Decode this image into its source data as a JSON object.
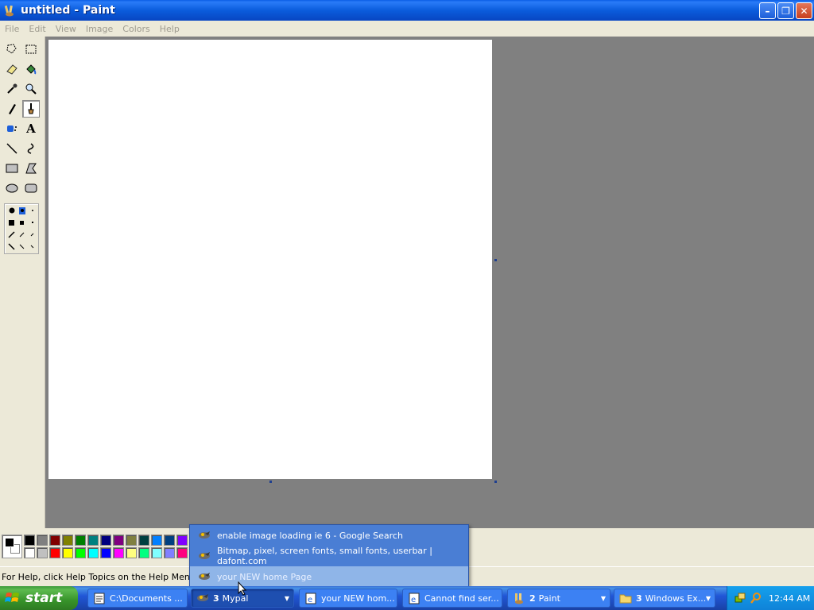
{
  "window": {
    "title": "untitled - Paint",
    "buttons": {
      "minimize": "–",
      "restore": "❐",
      "close": "✕"
    }
  },
  "menu": [
    "File",
    "Edit",
    "View",
    "Image",
    "Colors",
    "Help"
  ],
  "tools": [
    "free-form-select",
    "select",
    "eraser",
    "fill-with-color",
    "pick-color",
    "magnifier",
    "pencil",
    "brush",
    "airbrush",
    "text",
    "line",
    "curve",
    "rectangle",
    "polygon",
    "ellipse",
    "rounded-rectangle"
  ],
  "text_tool_label": "A",
  "palette": {
    "top": [
      "#000000",
      "#808080",
      "#800000",
      "#808000",
      "#008000",
      "#008080",
      "#000080",
      "#800080",
      "#808040",
      "#004040",
      "#0080ff",
      "#004080",
      "#8000ff"
    ],
    "bottom": [
      "#ffffff",
      "#c0c0c0",
      "#ff0000",
      "#ffff00",
      "#00ff00",
      "#00ffff",
      "#0000ff",
      "#ff00ff",
      "#ffff80",
      "#00ff80",
      "#80ffff",
      "#8080ff",
      "#ff0080"
    ]
  },
  "status": {
    "help_text": "For Help, click Help Topics on the Help Menu."
  },
  "popup": {
    "items": [
      "enable image loading ie 6 - Google Search",
      "Bitmap, pixel, screen fonts, small fonts, userbar | dafont.com",
      "your NEW home Page"
    ]
  },
  "taskbar": {
    "start_label": "start",
    "tasks": [
      {
        "label": "C:\\Documents ...",
        "count": ""
      },
      {
        "label": "Mypal",
        "count": "3"
      },
      {
        "label": "your NEW hom...",
        "count": ""
      },
      {
        "label": "Cannot find ser...",
        "count": ""
      },
      {
        "label": "Paint",
        "count": "2"
      },
      {
        "label": "Windows Ex...",
        "count": "3"
      }
    ],
    "clock": "12:44 AM"
  },
  "colors": {
    "titlebar": "#0a5cdc",
    "taskbar": "#2157d7",
    "start": "#37932a",
    "workspace": "#808080",
    "chrome": "#ece9d8"
  }
}
